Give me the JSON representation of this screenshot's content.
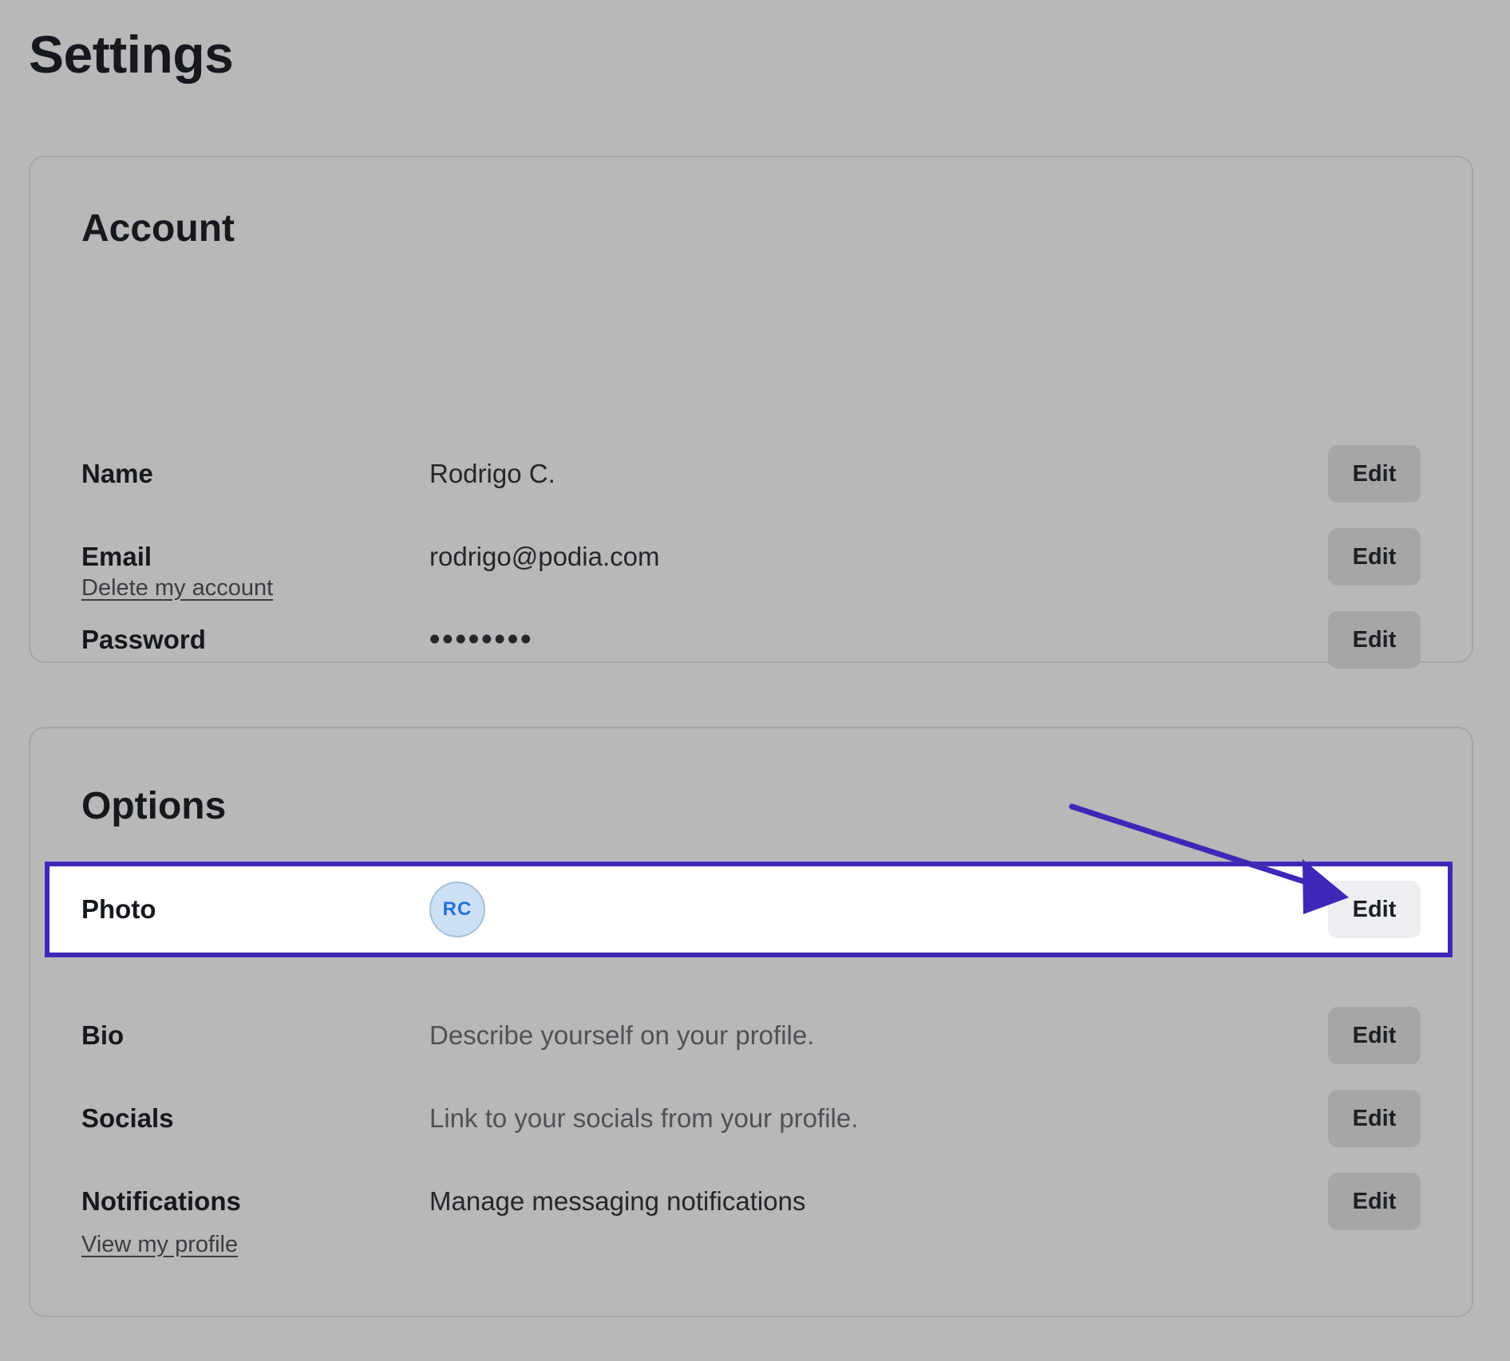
{
  "page": {
    "title": "Settings"
  },
  "account": {
    "title": "Account",
    "rows": [
      {
        "label": "Name",
        "value": "Rodrigo C.",
        "action": "Edit"
      },
      {
        "label": "Email",
        "value": "rodrigo@podia.com",
        "action": "Edit"
      },
      {
        "label": "Password",
        "value": "••••••••",
        "action": "Edit"
      }
    ],
    "delete_link": "Delete my account"
  },
  "options": {
    "title": "Options",
    "rows": [
      {
        "label": "Photo",
        "avatar_initials": "RC",
        "action": "Edit"
      },
      {
        "label": "Bio",
        "value": "Describe yourself on your profile.",
        "action": "Edit"
      },
      {
        "label": "Socials",
        "value": "Link to your socials from your profile.",
        "action": "Edit"
      },
      {
        "label": "Notifications",
        "value": "Manage messaging notifications",
        "action": "Edit"
      }
    ],
    "profile_link": "View my profile"
  },
  "annotation": {
    "highlighted_row": "Photo",
    "highlight_color": "#4027b8",
    "arrow_color": "#4027b8"
  },
  "colors": {
    "background": "#b8b8b8",
    "avatar_bg": "#cce0f5",
    "avatar_text": "#2470d8"
  }
}
